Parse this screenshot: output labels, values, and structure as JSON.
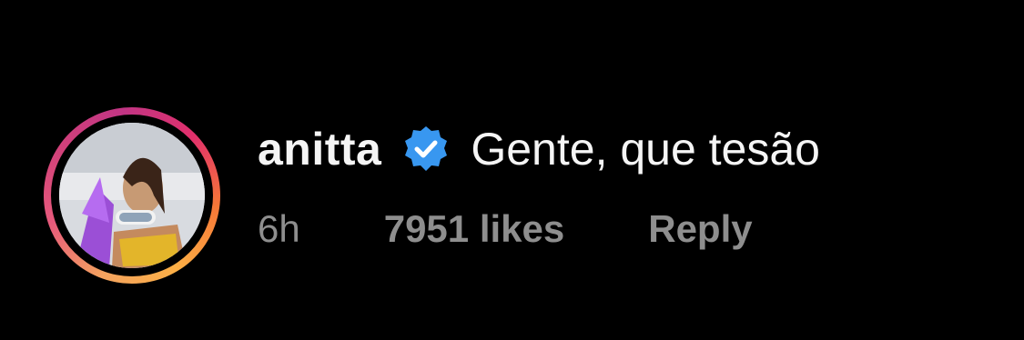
{
  "comment": {
    "username": "anitta",
    "verified_icon": "verified-badge-icon",
    "text": "Gente, que tesão",
    "time": "6h",
    "likes": "7951 likes",
    "reply_label": "Reply"
  },
  "colors": {
    "background": "#000000",
    "primary_text": "#f5f5f5",
    "secondary_text": "#8e8e8e",
    "verified_blue": "#3897f0",
    "ring_gradient": [
      "#fcaf45",
      "#f77737",
      "#e1306c",
      "#c13584"
    ]
  }
}
